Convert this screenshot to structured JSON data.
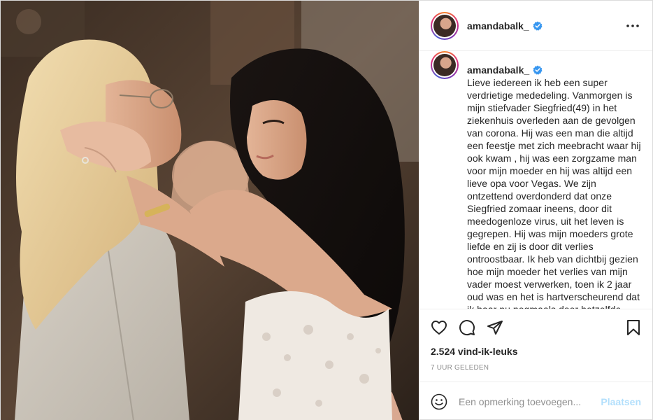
{
  "post": {
    "username": "amandabalk_",
    "verified": true,
    "caption": "Lieve iedereen ik heb een super verdrietige mededeling. Vanmorgen is mijn stiefvader Siegfried(49) in het ziekenhuis overleden aan de gevolgen van corona. Hij was een man die altijd een feestje met zich meebracht waar hij ook kwam , hij was een zorgzame man voor mijn moeder en hij was altijd een lieve opa voor Vegas. We zijn ontzettend overdonderd dat onze Siegfried zomaar ineens, door dit meedogenloze virus, uit het leven is gegrepen. Hij was mijn moeders grote liefde en zij is door dit verlies ontroostbaar. Ik heb van dichtbij gezien hoe mijn moeder het verlies van mijn vader moest verwerken, toen ik 2 jaar oud was en het is hartverscheurend dat ik haar nu nogmaals door hetzelfde proces moet zien gaan. Lieve mama, ondanks al het",
    "likes": "2.524 vind-ik-leuks",
    "time": "7 UUR GELEDEN"
  },
  "icons": {
    "more": "more-options-icon",
    "like": "heart-icon",
    "comment": "comment-icon",
    "share": "share-icon",
    "save": "bookmark-icon",
    "emoji": "emoji-icon",
    "verified": "verified-badge-icon"
  },
  "comment_box": {
    "placeholder": "Een opmerking toevoegen...",
    "post_label": "Plaatsen"
  },
  "colors": {
    "verified": "#3897f0",
    "post_button_disabled": "#b2dffc",
    "muted_text": "#8e8e8e",
    "text": "#262626"
  }
}
